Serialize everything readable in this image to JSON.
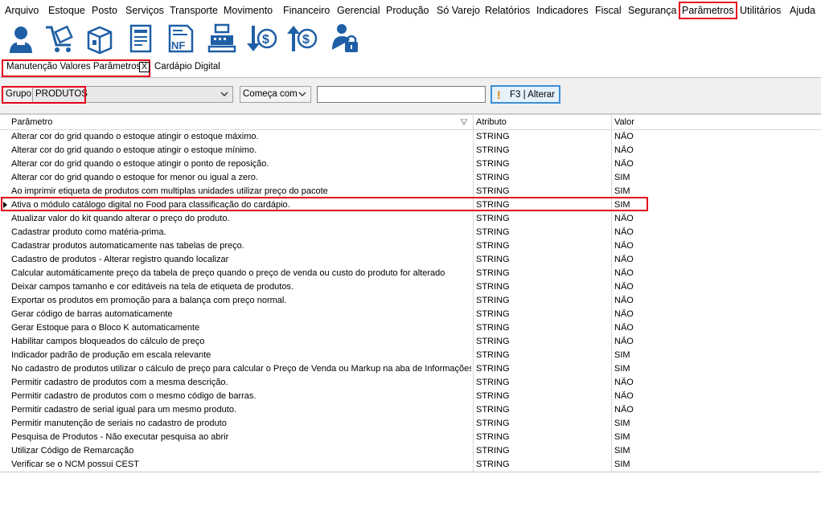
{
  "menu": [
    "Arquivo",
    "Estoque",
    "Posto",
    "Serviços",
    "Transporte",
    "Movimento",
    "Financeiro",
    "Gerencial",
    "Produção",
    "Só Varejo",
    "Relatórios",
    "Indicadores",
    "Fiscal",
    "Segurança",
    "Parâmetros",
    "Utilitários",
    "Ajuda"
  ],
  "toolbar": {
    "icons": [
      "user-icon",
      "cart-icon",
      "box-icon",
      "document-icon",
      "nf-invoice-icon",
      "cash-register-icon",
      "money-down-icon",
      "money-up-icon",
      "lock-user-icon"
    ],
    "nf_text": "NF"
  },
  "tabs": {
    "active": "Manutenção Valores Parâmetros",
    "close": "X",
    "other": "Cardápio Digital"
  },
  "filter": {
    "group_label": "Grupo",
    "group_value": "PRODUTOS",
    "mode_value": "Começa com",
    "search_value": "",
    "alter_label": "F3 | Alterar",
    "alter_icon_glyph": "!"
  },
  "grid": {
    "columns": [
      "Parâmetro",
      "Atributo",
      "Valor"
    ],
    "rows": [
      {
        "param": "Alterar cor do grid quando o estoque atingir o estoque máximo.",
        "attr": "STRING",
        "val": "NÃO"
      },
      {
        "param": "Alterar cor do grid quando o estoque atingir o estoque mínimo.",
        "attr": "STRING",
        "val": "NÃO"
      },
      {
        "param": "Alterar cor do grid quando o estoque atingir o ponto de reposição.",
        "attr": "STRING",
        "val": "NÃO"
      },
      {
        "param": "Alterar cor do grid quando o estoque for menor ou igual a zero.",
        "attr": "STRING",
        "val": "SIM"
      },
      {
        "param": "Ao imprimir etiqueta de produtos com multiplas unidades utilizar preço do pacote",
        "attr": "STRING",
        "val": "SIM"
      },
      {
        "param": "Ativa o módulo catálogo digital no Food para classificação do cardápio.",
        "attr": "STRING",
        "val": "SIM"
      },
      {
        "param": "Atualizar valor do kit quando alterar o preço do produto.",
        "attr": "STRING",
        "val": "NÃO"
      },
      {
        "param": "Cadastrar produto como matéria-prima.",
        "attr": "STRING",
        "val": "NÃO"
      },
      {
        "param": "Cadastrar produtos automaticamente nas tabelas de preço.",
        "attr": "STRING",
        "val": "NÃO"
      },
      {
        "param": "Cadastro de produtos - Alterar registro quando localizar",
        "attr": "STRING",
        "val": "NÃO"
      },
      {
        "param": "Calcular automáticamente preço da tabela de preço quando o preço de venda ou custo do produto for alterado",
        "attr": "STRING",
        "val": "NÃO"
      },
      {
        "param": "Deixar campos tamanho e cor editáveis na tela de etiqueta de produtos.",
        "attr": "STRING",
        "val": "NÃO"
      },
      {
        "param": "Exportar os produtos em promoção para a balança com preço normal.",
        "attr": "STRING",
        "val": "NÃO"
      },
      {
        "param": "Gerar código de barras automaticamente",
        "attr": "STRING",
        "val": "NÃO"
      },
      {
        "param": "Gerar Estoque para o Bloco K automaticamente",
        "attr": "STRING",
        "val": "NÃO"
      },
      {
        "param": "Habilitar campos bloqueados do cálculo de preço",
        "attr": "STRING",
        "val": "NÃO"
      },
      {
        "param": "Indicador padrão de produção em escala relevante",
        "attr": "STRING",
        "val": "SIM"
      },
      {
        "param": "No cadastro de produtos utilizar o cálculo de preço para calcular o Preço de Venda ou Markup na aba de Informações",
        "attr": "STRING",
        "val": "SIM"
      },
      {
        "param": "Permitir cadastro de produtos com a mesma descrição.",
        "attr": "STRING",
        "val": "NÃO"
      },
      {
        "param": "Permitir cadastro de produtos com o mesmo código de barras.",
        "attr": "STRING",
        "val": "NÃO"
      },
      {
        "param": "Permitir cadastro de serial igual para um mesmo produto.",
        "attr": "STRING",
        "val": "NÃO"
      },
      {
        "param": "Permitir manutenção de seriais no cadastro de produto",
        "attr": "STRING",
        "val": "SIM"
      },
      {
        "param": "Pesquisa de Produtos - Não executar pesquisa ao abrir",
        "attr": "STRING",
        "val": "SIM"
      },
      {
        "param": "Utilizar Código de Remarcação",
        "attr": "STRING",
        "val": "SIM"
      },
      {
        "param": "Verificar se o NCM possui CEST",
        "attr": "STRING",
        "val": "SIM"
      }
    ],
    "selected_row": 5
  },
  "colors": {
    "highlight": "#e3001b",
    "accent": "#1a5fa8",
    "button_border": "#3c8fd6"
  }
}
